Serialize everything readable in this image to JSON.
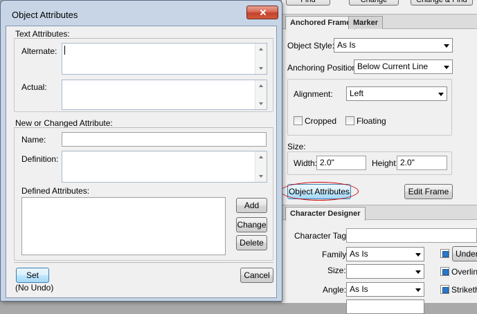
{
  "dialog": {
    "title": "Object Attributes",
    "text_attributes_label": "Text Attributes:",
    "alternate_label": "Alternate:",
    "alternate_value": "",
    "actual_label": "Actual:",
    "actual_value": "",
    "new_changed_label": "New or Changed Attribute:",
    "name_label": "Name:",
    "name_value": "",
    "definition_label": "Definition:",
    "definition_value": "",
    "defined_attributes_label": "Defined Attributes:",
    "defined_attributes": [],
    "add_button": "Add",
    "change_button": "Change",
    "delete_button": "Delete",
    "set_button": "Set",
    "no_undo_label": "(No Undo)",
    "cancel_button": "Cancel"
  },
  "right_panel": {
    "top_buttons": [
      "Find",
      "Change",
      "Change & Find"
    ],
    "tabs": [
      "Anchored Frame",
      "Marker"
    ],
    "object_style_label": "Object Style:",
    "object_style_value": "As Is",
    "anchoring_position_label": "Anchoring Position:",
    "anchoring_position_value": "Below Current Line",
    "alignment_label": "Alignment:",
    "alignment_value": "Left",
    "cropped_label": "Cropped",
    "floating_label": "Floating",
    "size_label": "Size:",
    "width_label": "Width:",
    "width_value": "2.0\"",
    "height_label": "Height:",
    "height_value": "2.0\"",
    "object_attributes_button": "Object Attributes",
    "edit_frame_button": "Edit Frame",
    "character_designer_tab": "Character Designer",
    "character_tag_label": "Character Tag:",
    "character_tag_value": "",
    "family_label": "Family:",
    "family_value": "As Is",
    "size_field_label": "Size:",
    "size_value": "",
    "angle_label": "Angle:",
    "angle_value": "As Is",
    "underline_label": "Underli",
    "overline_label": "Overline",
    "strikethrough_label": "Strikethr"
  },
  "colors": {
    "highlight_ellipse": "#d00000",
    "checkbox_checked": "#2b78c7",
    "close_button": "#c2422b"
  }
}
